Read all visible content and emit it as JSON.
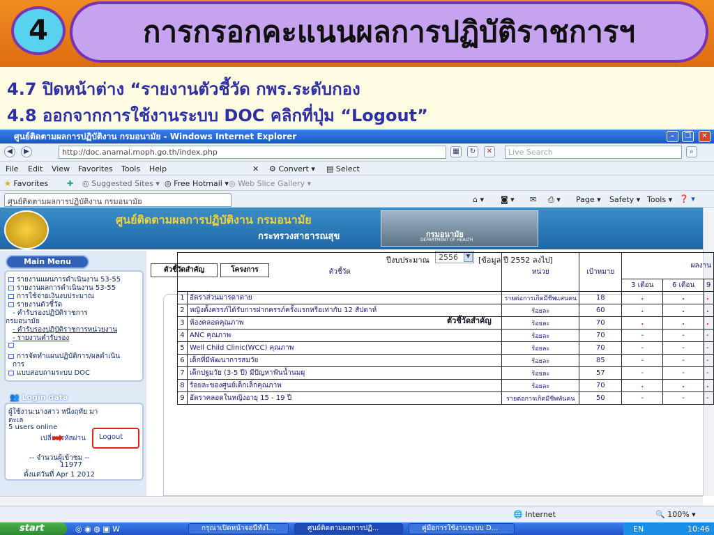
{
  "slide": {
    "step_number": "4",
    "title": "การกรอกคะแนนผลการปฏิบัติราชการฯ",
    "line1": "4.7 ปิดหน้าต่าง “รายงานตัวชี้วัด กพร.ระดับกอง",
    "line2": "4.8 ออกจากการใช้งานระบบ DOC คลิกที่ปุ่ม “Logout”"
  },
  "browser": {
    "window_title": "ศูนย์ติดตามผลการปฏิบัติงาน กรมอนามัย - Windows Internet Explorer",
    "address": "http://doc.anamai.moph.go.th/index.php",
    "search_placeholder": "Live Search",
    "menu": [
      "File",
      "Edit",
      "View",
      "Favorites",
      "Tools",
      "Help"
    ],
    "convert_label": "Convert",
    "select_label": "Select",
    "favorites_label": "Favorites",
    "fav_links": [
      "Suggested Sites",
      "Free Hotmail",
      "Web Slice Gallery"
    ],
    "tab_title": "ศูนย์ติดตามผลการปฏิบัติงาน กรมอนามัย",
    "cmd": [
      "Page",
      "Safety",
      "Tools"
    ],
    "status_zone": "Internet",
    "zoom": "100%"
  },
  "site": {
    "banner_title": "ศูนย์ติดตามผลการปฏิบัติงาน กรมอนามัย",
    "banner_subtitle": "กระทรวงสาธารณสุข",
    "dept_name": "กรมอนามัย",
    "dept_en": "DEPARTMENT OF HEALTH",
    "main_menu_label": "Main Menu",
    "menu_items": [
      "รายงานแผนการดำเนินงาน 53-55",
      "รายงานผลการดำเนินงาน 53-55",
      "การใช้จ่ายเงินงบประมาณ",
      "รายงานตัวชี้วัด",
      "- คำรับรองปฏิบัติราชการ",
      "กรมอนามัย",
      "- คำรับรองปฏิบัติราชการหน่วยงาน",
      "- รายงานคำรับรอง",
      "",
      "การจัดทำแผนปฏิบัติการ/ผลดำเนิน",
      "การ",
      "แบบสอบถามระบบ DOC"
    ],
    "login_label": "Login data",
    "user_line1": "ผู้ใช้งาน:นางสาว หนึ่งฤทัย มา",
    "user_line2": "ตะเล",
    "users_online": "5 users online",
    "change_password": "เปลี่ยนรหัสผ่าน",
    "logout": "Logout",
    "visitors_label": "-- จำนวนผู้เข้าชม --",
    "visitors": "11977",
    "since": "ตั้งแต่วันที่ Apr 1 2012",
    "fiscal_label": "ปีงบประมาณ",
    "fiscal_year": "2556",
    "fiscal_note": "[ข้อมูล ปี 2552 ลงไป]",
    "tabs": [
      "ตัวชี้วัดสำคัญ",
      "โครงการ"
    ],
    "table_title": "ตัวชี้วัดสำคัญ",
    "col_headers": [
      "ตัวชี้วัด",
      "หน่วย",
      "เป้าหมาย",
      "ผลงาน"
    ],
    "sub_headers": [
      "3 เดือน",
      "6 เดือน",
      "9"
    ],
    "rows": [
      {
        "no": "1",
        "name": "อัตราส่วนมารดาตาย",
        "unit": "รายต่อการเกิดมีชีพแสนคน",
        "target": "18",
        "m3": ".",
        "m6": ".",
        "m9": "."
      },
      {
        "no": "2",
        "name": "หญิงตั้งครรภ์ได้รับการฝากครรภ์ครั้งแรกหรือเท่ากับ 12 สัปดาห์",
        "unit": "ร้อยละ",
        "target": "60",
        "m3": ".",
        "m6": ".",
        "m9": "."
      },
      {
        "no": "3",
        "name": "ห้องคลอดคุณภาพ",
        "unit": "ร้อยละ",
        "target": "70",
        "m3": ".",
        "m6": ".",
        "m9": "."
      },
      {
        "no": "4",
        "name": "ANC คุณภาพ",
        "unit": "ร้อยละ",
        "target": "70",
        "m3": "-",
        "m6": "-",
        "m9": "-"
      },
      {
        "no": "5",
        "name": "Well Child Clinic(WCC) คุณภาพ",
        "unit": "ร้อยละ",
        "target": "70",
        "m3": "-",
        "m6": "-",
        "m9": "-"
      },
      {
        "no": "6",
        "name": "เด็กที่มีพัฒนาการสมวัย",
        "unit": "ร้อยละ",
        "target": "85",
        "m3": "-",
        "m6": "-",
        "m9": "-"
      },
      {
        "no": "7",
        "name": "เด็กปฐมวัย (3-5 ปี) มีปัญหาฟันน้ำนมผุ",
        "unit": "ร้อยละ",
        "target": "57",
        "m3": "-",
        "m6": "-",
        "m9": "-"
      },
      {
        "no": "8",
        "name": "ร้อยละของศูนย์เด็กเล็กคุณภาพ",
        "unit": "ร้อยละ",
        "target": "70",
        "m3": ".",
        "m6": ".",
        "m9": "."
      },
      {
        "no": "9",
        "name": "อัตราคลอดในหญิงอายุ 15 - 19 ปี",
        "unit": "รายต่อการเกิดมีชีพพันคน",
        "target": "50",
        "m3": "-",
        "m6": "-",
        "m9": "-"
      }
    ]
  },
  "taskbar": {
    "start": "start",
    "items": [
      "กรุณาเปิดหน้าจอนี้ทั้งไ...",
      "ศูนย์ติดตามผลการปฏิ...",
      "คู่มือการใช้งานระบบ D..."
    ],
    "lang": "EN",
    "time": "10:46"
  }
}
